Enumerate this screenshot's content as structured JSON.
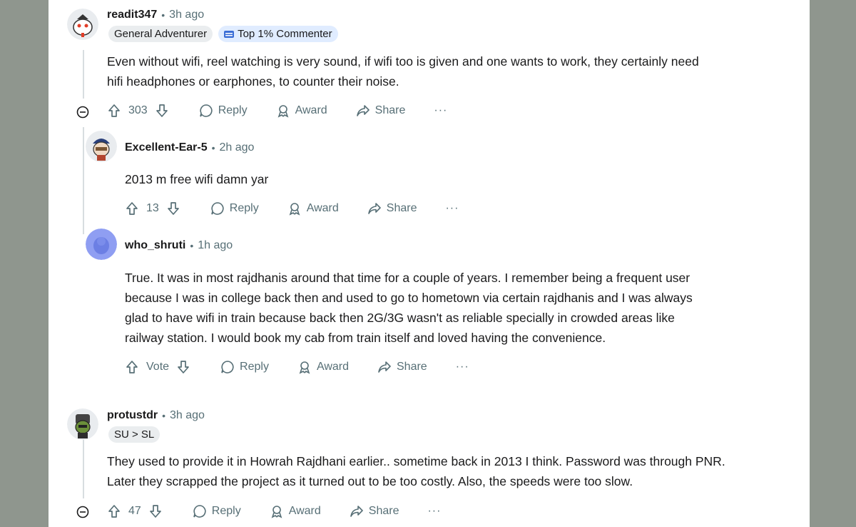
{
  "comments": [
    {
      "username": "readit347",
      "time": "3h ago",
      "flairs": [
        "General Adventurer",
        "Top 1% Commenter"
      ],
      "lines": [
        "Even without wifi, reel watching is very sound, if wifi too is given and one wants to work, they certainly need",
        "hifi headphones or earphones, to counter their noise."
      ],
      "score": "303"
    },
    {
      "username": "Excellent-Ear-5",
      "time": "2h ago",
      "lines": [
        "2013 m free wifi damn yar"
      ],
      "score": "13"
    },
    {
      "username": "who_shruti",
      "time": "1h ago",
      "lines": [
        "True. It was in most rajdhanis around that time for a couple of years. I remember being a frequent user",
        "because I was in college back then and used to go to hometown via certain rajdhanis and I was always",
        "glad to have wifi in train because back then 2G/3G wasn't as reliable specially in crowded areas like",
        "railway station. I would book my cab from train itself and loved having the convenience."
      ],
      "score": "Vote"
    },
    {
      "username": "protustdr",
      "time": "3h ago",
      "flairs": [
        "SU > SL"
      ],
      "lines": [
        "They used to provide it in Howrah Rajdhani earlier.. sometime back in 2013 I think. Password was through PNR.",
        "Later they scrapped the project as it turned out to be too costly. Also, the speeds were too slow."
      ],
      "score": "47"
    }
  ],
  "actions": {
    "reply": "Reply",
    "award": "Award",
    "share": "Share",
    "more": "···"
  },
  "separator": "•",
  "colors": {
    "background": "#8f968e",
    "panel": "#ffffff",
    "meta": "#576f76",
    "flair": "#eaedef",
    "flair_blue": "#e0ecff"
  }
}
